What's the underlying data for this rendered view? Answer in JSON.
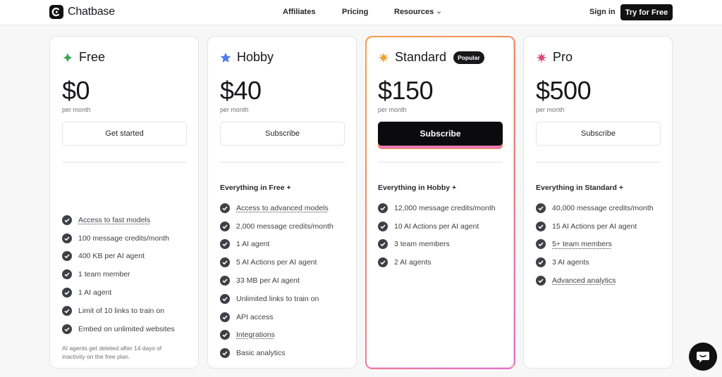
{
  "brand": {
    "name": "Chatbase"
  },
  "nav": {
    "links": [
      "Affiliates",
      "Pricing",
      "Resources"
    ],
    "signin": "Sign in",
    "cta": "Try for Free"
  },
  "plans": [
    {
      "name": "Free",
      "icon": "sparkle-icon",
      "icon_color": "#3aa856",
      "price": "$0",
      "period": "per month",
      "cta": "Get started",
      "header": "",
      "features": [
        "Access to fast models",
        "100 message credits/month",
        "400 KB per AI agent",
        "1 team member",
        "1 AI agent",
        "Limit of 10 links to train on",
        "Embed on unlimited websites"
      ],
      "note": "AI agents get deleted after 14 days of inactivity on the free plan."
    },
    {
      "name": "Hobby",
      "icon": "star-icon",
      "icon_color": "#4f7bea",
      "price": "$40",
      "period": "per month",
      "cta": "Subscribe",
      "header": "Everything in Free +",
      "features": [
        "Access to advanced models",
        "2,000 message credits/month",
        "1 AI agent",
        "5 AI Actions per AI agent",
        "33 MB per AI agent",
        "Unlimited links to train on",
        "API access",
        "Integrations",
        "Basic analytics"
      ]
    },
    {
      "name": "Standard",
      "icon": "burst-icon",
      "icon_color": "#f0a32e",
      "badge": "Popular",
      "price": "$150",
      "period": "per month",
      "cta": "Subscribe",
      "header": "Everything in Hobby +",
      "features": [
        "12,000 message credits/month",
        "10 AI Actions per AI agent",
        "3 team members",
        "2 AI agents"
      ]
    },
    {
      "name": "Pro",
      "icon": "burst-icon",
      "icon_color": "#e0457b",
      "price": "$500",
      "period": "per month",
      "cta": "Subscribe",
      "header": "Everything in Standard +",
      "features": [
        "40,000 message credits/month",
        "15 AI Actions per AI agent",
        "5+ team members",
        "3 AI agents",
        "Advanced analytics"
      ]
    }
  ],
  "chat_widget": {
    "icon": "chat-icon"
  }
}
